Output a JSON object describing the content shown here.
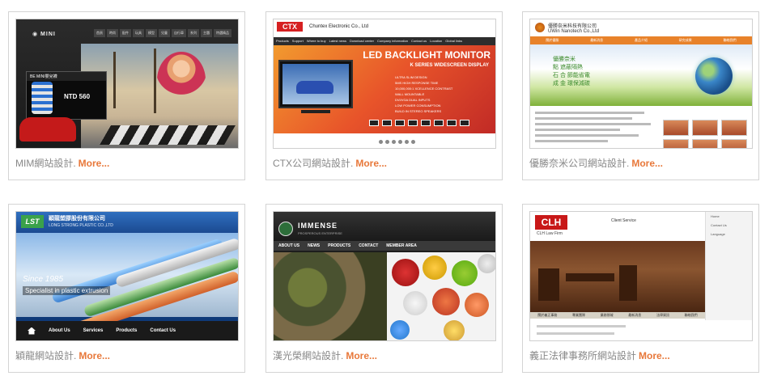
{
  "more_label": "More...",
  "cards": [
    {
      "caption": "MIM網站設計.",
      "thumb": {
        "nav": [
          "首頁",
          "時尚",
          "配件",
          "玩具",
          "模型",
          "兒童",
          "自行車",
          "系列",
          "主題",
          "特選精品"
        ],
        "promo_title": "BE MINI嬰兒襪",
        "promo_price": "NTD 560"
      }
    },
    {
      "caption": "CTX公司網站設計.",
      "thumb": {
        "brand": "CTX",
        "company": "Chuntex Electronic Co., Ltd",
        "menu": [
          "Products",
          "Support",
          "Where to buy",
          "Latest news",
          "Download center",
          "Company information",
          "Contact us",
          "Location",
          "Global links"
        ],
        "headline": "LED BACKLIGHT MONITOR",
        "series": "K SERIES WIDESCREEN DISPLAY",
        "features": [
          "ULTRA SLIM DESIGN",
          "5MS HIGH RESPONSE TIME",
          "10,000,000:1 XCELLENCE CONTRAST",
          "WALL MOUNTABLE",
          "DVI/VGA DUAL INPUTS",
          "LOW POWER CONSUMPTION",
          "BUILD IN STEREO SPEAKERS"
        ]
      }
    },
    {
      "caption": "優勝奈米公司網站設計.",
      "thumb": {
        "name_cn": "優勝奈米科技有限公司",
        "name_en": "UWin Nanotech Co.,Ltd",
        "menu": [
          "關於優勝",
          "最新消息",
          "產品介紹",
          "研究成果",
          "聯絡我們"
        ],
        "slogan": [
          "優勝奈米",
          "點 遮蔽隔熱",
          "石 合 節能省電",
          "成 金 環保減碳"
        ]
      }
    },
    {
      "caption": "穎龍網站設計.",
      "thumb": {
        "logo": "LST",
        "name_cn": "穎龍塑膠股份有限公司",
        "name_en": "LONG STRONG PLASTIC CO.,LTD",
        "since": "Since 1985",
        "specialist": "Specialist in plastic extrusion",
        "nav": [
          "About Us",
          "Services",
          "Products",
          "Contact Us"
        ]
      }
    },
    {
      "caption": "漢光榮網站設計.",
      "thumb": {
        "name": "IMMENSE",
        "tagline": "PROSPEROUS ENTERPRISE",
        "nav": [
          "ABOUT US",
          "NEWS",
          "PRODUCTS",
          "CONTACT",
          "MEMBER AREA"
        ]
      }
    },
    {
      "caption": "義正法律事務所網站設計",
      "thumb": {
        "logo": "CLH",
        "firm": "CLH Law Firm",
        "service_title": "Client Service",
        "side": [
          "Home",
          "Contact Us",
          "Language"
        ],
        "menu": [
          "關於義正事務",
          "專業團隊",
          "業務領域",
          "最新消息",
          "法律資訊",
          "聯絡我們"
        ]
      }
    }
  ],
  "colors": {
    "caption": "#888888",
    "more": "#e8783a",
    "border": "#d4d4d4"
  }
}
